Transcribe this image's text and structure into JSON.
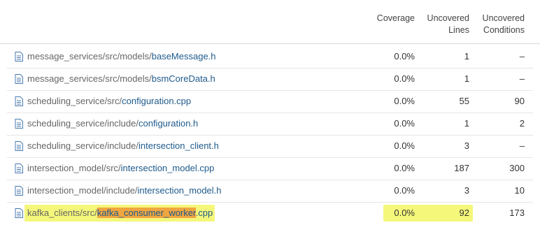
{
  "header": {
    "coverage": "Coverage",
    "uncovered_lines_1": "Uncovered",
    "uncovered_lines_2": "Lines",
    "uncovered_conditions_1": "Uncovered",
    "uncovered_conditions_2": "Conditions"
  },
  "rows": [
    {
      "dir": "message_services/src/models/",
      "file": "baseMessage.h",
      "coverage": "0.0%",
      "lines": "1",
      "conditions": "–"
    },
    {
      "dir": "message_services/src/models/",
      "file": "bsmCoreData.h",
      "coverage": "0.0%",
      "lines": "1",
      "conditions": "–"
    },
    {
      "dir": "scheduling_service/src/",
      "file": "configuration.cpp",
      "coverage": "0.0%",
      "lines": "55",
      "conditions": "90"
    },
    {
      "dir": "scheduling_service/include/",
      "file": "configuration.h",
      "coverage": "0.0%",
      "lines": "1",
      "conditions": "2"
    },
    {
      "dir": "scheduling_service/include/",
      "file": "intersection_client.h",
      "coverage": "0.0%",
      "lines": "3",
      "conditions": "–"
    },
    {
      "dir": "intersection_model/src/",
      "file": "intersection_model.cpp",
      "coverage": "0.0%",
      "lines": "187",
      "conditions": "300"
    },
    {
      "dir": "intersection_model/include/",
      "file": "intersection_model.h",
      "coverage": "0.0%",
      "lines": "3",
      "conditions": "10"
    },
    {
      "dir": "kafka_clients/src/",
      "file_main": "kafka_consumer_worker",
      "file_ext": ".cpp",
      "coverage": "0.0%",
      "lines": "92",
      "conditions": "173"
    }
  ],
  "icons": {
    "file": "file-icon"
  },
  "colors": {
    "link": "#1e5a8c",
    "highlight_yellow": "#f5f77a",
    "highlight_orange": "#f0a640"
  }
}
